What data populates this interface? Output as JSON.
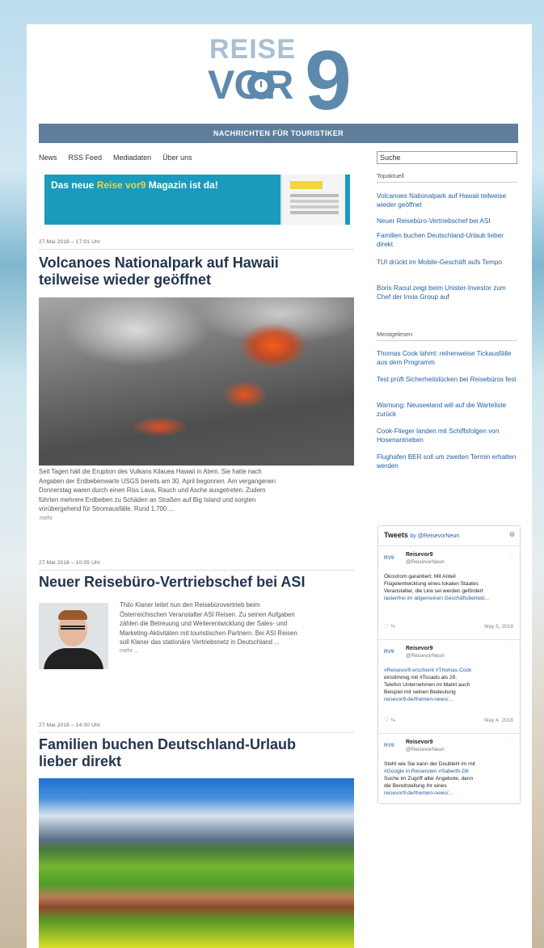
{
  "logo": {
    "line1": "REISE",
    "line2": "VOR",
    "numeral": "9"
  },
  "header": {
    "banner": "NACHRICHTEN FÜR TOURISTIKER"
  },
  "nav": [
    "News",
    "RSS Feed",
    "Mediadaten",
    "Über uns"
  ],
  "search": {
    "value": "Suche"
  },
  "magazine": {
    "title_prefix": "Das neue ",
    "title_highlight": "Reise vor9",
    "title_suffix": " Magazin ist da!"
  },
  "articles": [
    {
      "date": "27.Mai 2018 – 17:01 Uhr",
      "title_line1": "Volcanoes Nationalpark auf Hawaii",
      "title_line2": "teilweise wieder geöffnet",
      "teaser": [
        "Seit Tagen hält die Eruption des Vulkans Kilauea Hawaii in Atem. Sie hatte nach",
        "Angaben der Erdbebenwarte USGS bereits am 30. April begonnen. Am vergangenen",
        "Donnerstag waren durch einen Riss Lava, Rauch und Asche ausgetreten. Zudem",
        "führten mehrere Erdbeben zu Schäden an Straßen auf Big Island und sorgten",
        "vorübergehend für Stromausfälle. Rund 1.700 ..."
      ],
      "more": "mehr"
    },
    {
      "date": "27.Mai 2018 – 10:05 Uhr",
      "title": "Neuer Reisebüro-Vertriebschef bei ASI",
      "teaser": [
        "Thilo Klaner leitet nun den Reisebürovertrieb beim",
        "Österreichischen Veranstalter ASI Reisen. Zu seinen Aufgaben",
        "zählen die Betreuung und Weiterentwicklung der Sales- und",
        "Marketing-Aktivitäten mit touristischen Partnern. Bei ASI Reisen",
        "soll Klaner das stationäre Vertriebsnetz in Deutschland ..."
      ],
      "more": "mehr ..."
    },
    {
      "date": "27.Mai 2018 – 14:00 Uhr",
      "title_line1": "Familien buchen Deutschland-Urlaub",
      "title_line2": "lieber direkt"
    }
  ],
  "sidebar": {
    "section1_title": "Topaktuell",
    "section1_items": [
      "Volcanoes Nationalpark auf Hawaii teilweise wieder geöffnet",
      "Neuer Reisebüro-Vertriebschef bei ASI",
      "Familien buchen Deutschland-Urlaub lieber direkt",
      "TUI drückt im Mobile-Geschäft aufs Tempo",
      "Boris Raoul zeigt beim Unister-Investor zum Chef der Invia Group auf"
    ],
    "section2_title": "Meistgelesen",
    "section2_items": [
      "Thomas Cook lahmt: reihenweise Tickausfälle aus dem Programm",
      "Test prüft Sicherheitslücken bei Reisebüros fest",
      "Warnung: Neuseeland will auf die Warteliste zurück",
      "Cook-Flieger landen mit Schiffsfolgen von Hosenantrieben",
      "Flughafen BER soll um zweiten Termin erhalten werden"
    ]
  },
  "tweets": {
    "header": "Tweets",
    "by": "by @ReisevorNeun",
    "items": [
      {
        "avatar": "RV9",
        "name": "Reisevor9",
        "handle": "@ReisevorNeun",
        "body_line1": "Ökostrom garantiert: Mit Anteil",
        "body_line2": "Flügelentwicklung eines lokalen Staates",
        "body_line3": "Veranstalter, die Lkw sei werden gefördert",
        "body_line4": "lastenfrei im allgemeinen Geschäftsbetrieb...",
        "date": "May 5, 2018"
      },
      {
        "avatar": "RV9",
        "name": "Reisevor9",
        "handle": "@ReisevorNeun",
        "body_line1": "#Reisevor9 erscheint #Thomas Cook",
        "body_line2": "einstimmig mit #Tocado als 29.",
        "body_line3": "Telefon Unternehmen im Markt auch",
        "body_line4": "Beispiel mit seinen Bedeutung",
        "body_line5": "reisevor9.de/themen-news/...",
        "date": "May 4, 2018"
      },
      {
        "avatar": "RV9",
        "name": "Reisevor9",
        "handle": "@ReisevorNeun",
        "body_line1": "Steht wie Sie kann der DoubleH im mit",
        "body_line2": "#Google in Reiseruten #Saberth-D6",
        "body_line3": "Suche im Zugriff aller Angebote, denn",
        "body_line4": "die Bereitstellung Ihr eines",
        "body_line5": "reisevor9.de/themen-news/..."
      }
    ]
  }
}
